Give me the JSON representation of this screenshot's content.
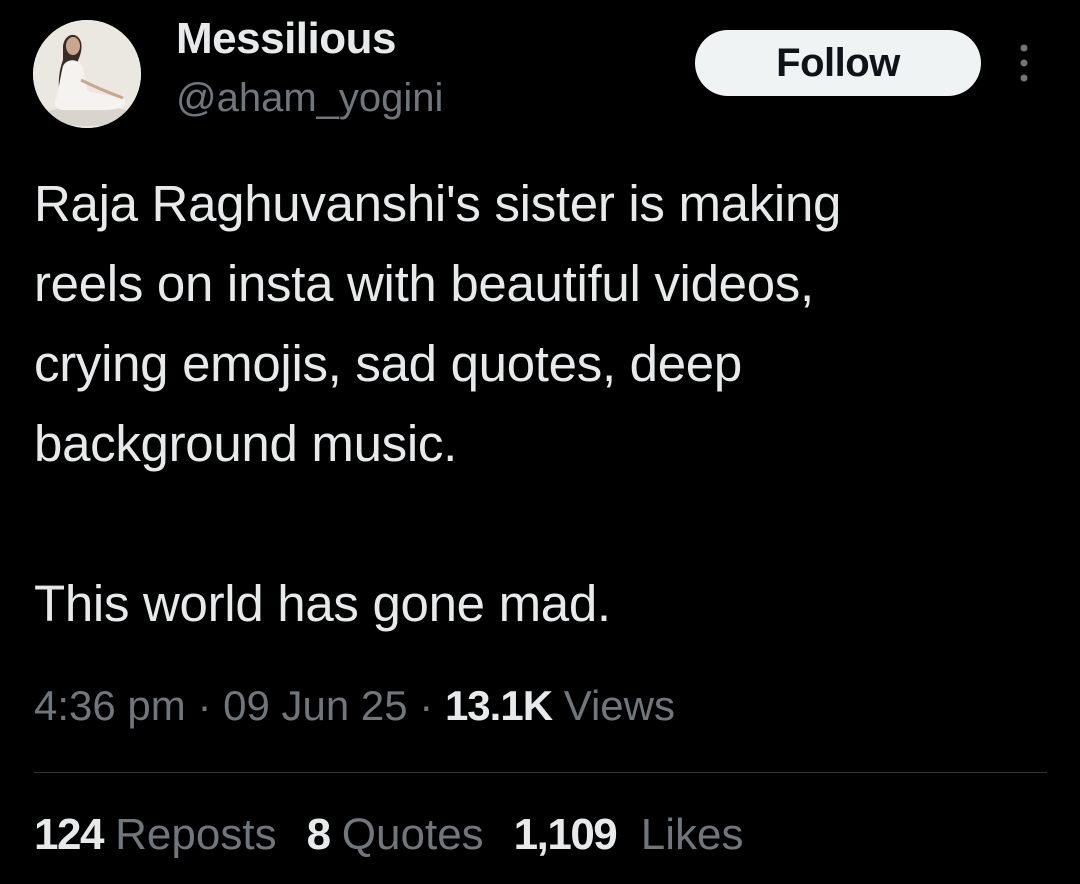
{
  "author": {
    "display_name": "Messilious",
    "handle": "@aham_yogini",
    "avatar_icon": "meditating-woman-avatar"
  },
  "follow_button": {
    "label": "Follow"
  },
  "more_menu": {
    "icon": "more-vertical-icon"
  },
  "tweet": {
    "text_lines": [
      "Raja Raghuvanshi's sister is making",
      "reels on insta with beautiful videos,",
      "crying emojis, sad quotes, deep",
      "background music."
    ],
    "closing_line": "This world has gone mad."
  },
  "meta": {
    "time": "4:36 pm",
    "separator": "·",
    "date": "09 Jun 25",
    "views_count": "13.1K",
    "views_label": "Views"
  },
  "stats": {
    "reposts": {
      "count": "124",
      "label": "Reposts"
    },
    "quotes": {
      "count": "8",
      "label": "Quotes"
    },
    "likes": {
      "count": "1,109",
      "label": "Likes"
    }
  },
  "colors": {
    "background": "#000000",
    "primary_text": "#e7e9ea",
    "secondary_text": "#71767b",
    "follow_bg": "#eff3f4",
    "divider": "#2f3336"
  }
}
